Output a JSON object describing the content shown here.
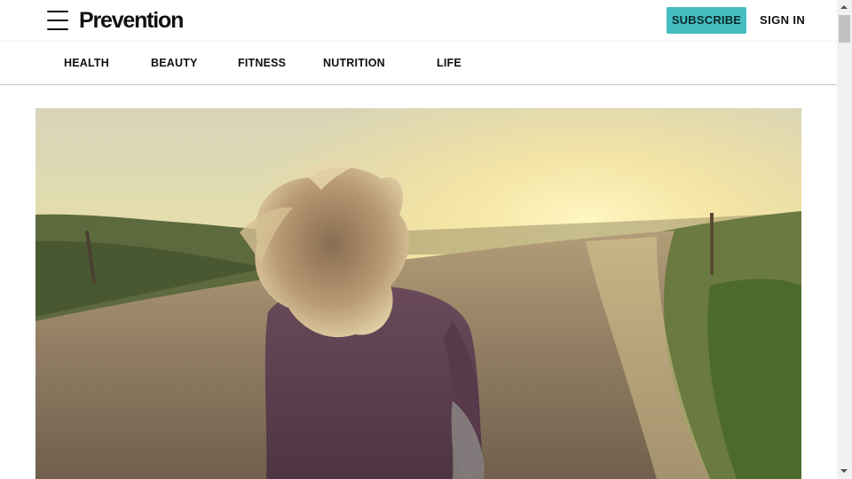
{
  "header": {
    "logo_text": "Prevention",
    "menu_icon": "hamburger-menu-icon",
    "subscribe_label": "SUBSCRIBE",
    "signin_label": "SIGN IN"
  },
  "nav": {
    "items": [
      {
        "label": "HEALTH"
      },
      {
        "label": "BEAUTY"
      },
      {
        "label": "FITNESS"
      },
      {
        "label": "NUTRITION"
      },
      {
        "label": "LIFE"
      }
    ]
  },
  "hero": {
    "description_icon": "hero-photo"
  },
  "colors": {
    "accent": "#44bdc0",
    "text": "#111111",
    "divider": "#c9c9c9"
  }
}
